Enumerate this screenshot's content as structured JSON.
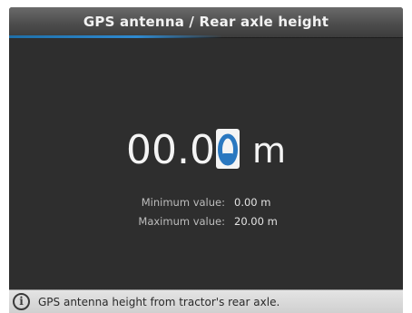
{
  "title": "GPS antenna / Rear axle height",
  "input": {
    "value_prefix": "00.0",
    "cursor_digit": "0",
    "unit": "m"
  },
  "limits": {
    "min_label": "Minimum value:",
    "min_value": "0.00 m",
    "max_label": "Maximum value:",
    "max_value": "20.00 m"
  },
  "info": {
    "icon": "info-icon",
    "text": "GPS antenna height from tractor's rear axle."
  },
  "colors": {
    "screen_background": "#2e2e2e",
    "title_accent": "#2f8ad0",
    "cursor_digit_color": "#2a78c0"
  }
}
